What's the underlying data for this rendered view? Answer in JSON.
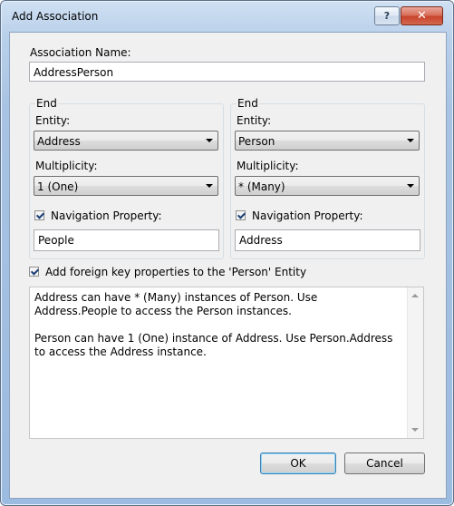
{
  "window": {
    "title": "Add Association",
    "help_label": "?",
    "close_label": "✕"
  },
  "association_name": {
    "label": "Association Name:",
    "value": "AddressPerson"
  },
  "left_end": {
    "group_label": "End",
    "entity_label": "Entity:",
    "entity_value": "Address",
    "multiplicity_label": "Multiplicity:",
    "multiplicity_value": "1 (One)",
    "nav_property_label": "Navigation Property:",
    "nav_property_checked": true,
    "nav_property_value": "People"
  },
  "right_end": {
    "group_label": "End",
    "entity_label": "Entity:",
    "entity_value": "Person",
    "multiplicity_label": "Multiplicity:",
    "multiplicity_value": "* (Many)",
    "nav_property_label": "Navigation Property:",
    "nav_property_checked": true,
    "nav_property_value": "Address"
  },
  "foreign_key": {
    "label": "Add foreign key properties to the 'Person' Entity",
    "checked": true
  },
  "description": {
    "line1": "Address can have * (Many) instances of Person. Use Address.People to access the Person instances.",
    "line2": "Person can have 1 (One) instance of Address. Use Person.Address to access the Address instance."
  },
  "buttons": {
    "ok": "OK",
    "cancel": "Cancel"
  }
}
